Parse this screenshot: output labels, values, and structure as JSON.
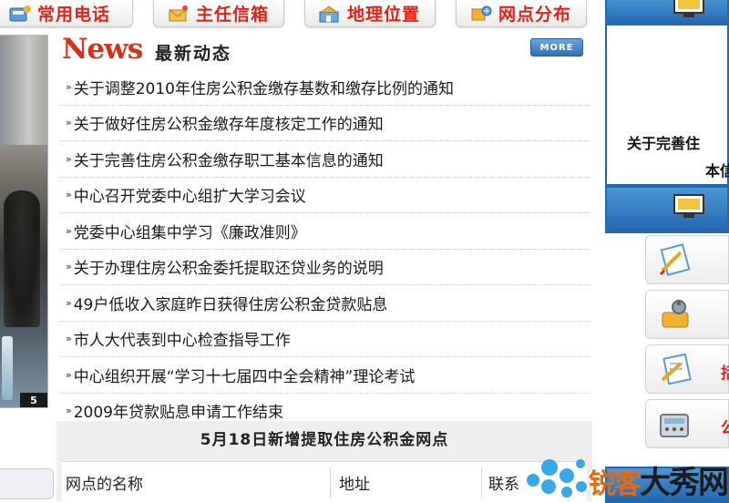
{
  "top_nav": [
    {
      "label": "常用电话",
      "icon": "phone-book-icon"
    },
    {
      "label": "主任信箱",
      "icon": "mailbox-icon"
    },
    {
      "label": "地理位置",
      "icon": "location-icon"
    },
    {
      "label": "网点分布",
      "icon": "network-icon"
    }
  ],
  "photo": {
    "index": "5"
  },
  "news": {
    "title_en": "News",
    "title_cn": "最新动态",
    "more_label": "MORE",
    "items": [
      "关于调整2010年住房公积金缴存基数和缴存比例的通知",
      "关于做好住房公积金缴存年度核定工作的通知",
      "关于完善住房公积金缴存职工基本信息的通知",
      "中心召开党委中心组扩大学习会议",
      "党委中心组集中学习《廉政准则》",
      "关于办理住房公积金委托提取还贷业务的说明",
      "49户低收入家庭昨日获得住房公积金贷款贴息",
      "市人大代表到中心检查指导工作",
      "中心组织开展“学习十七届四中全会精神”理论考试",
      "2009年贷款贴息申请工作结束"
    ]
  },
  "notice": {
    "title": "5月18日新增提取住房公积金网点",
    "columns": [
      "网点的名称",
      "地址",
      "联系"
    ]
  },
  "right_panel": {
    "notice_line1": "关于完善住",
    "notice_line2": "本信",
    "services": [
      {
        "label": "",
        "icon": "notepad-icon"
      },
      {
        "label": "",
        "icon": "tools-icon"
      },
      {
        "label": "括",
        "icon": "form-icon"
      },
      {
        "label": "公",
        "icon": "calculator-icon"
      }
    ]
  },
  "watermark": {
    "brand": "大秀网",
    "brand_small": "锐客"
  },
  "colors": {
    "accent_red": "#d8261a",
    "panel_blue": "#2468ad"
  }
}
